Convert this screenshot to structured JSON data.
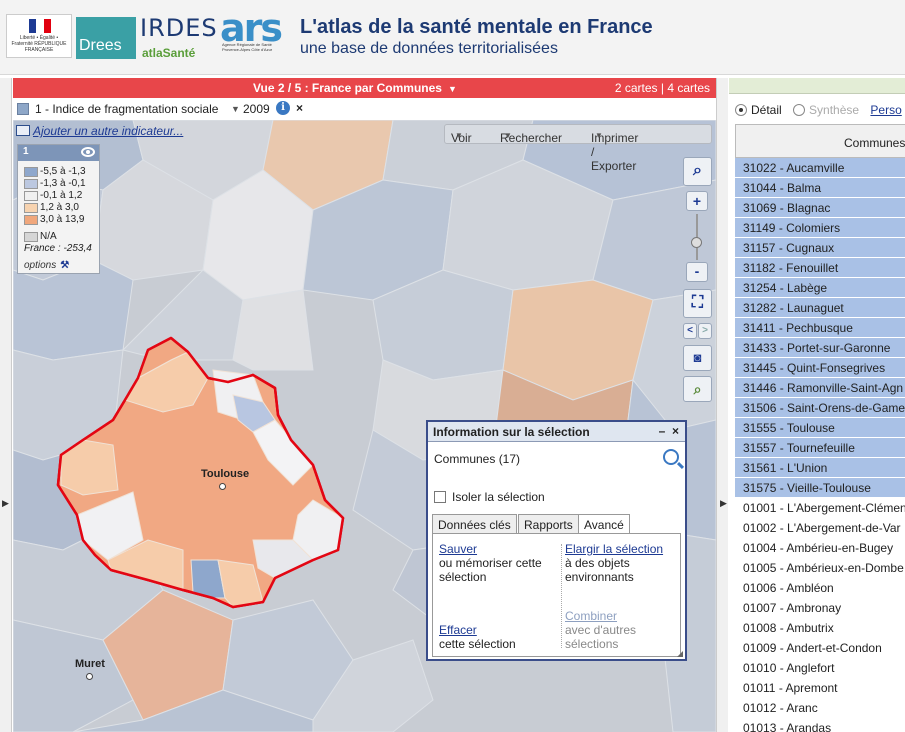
{
  "header": {
    "logo_rf_text": "Liberté • Égalité • Fraternité RÉPUBLIQUE FRANÇAISE",
    "logo_drees": "Drees",
    "logo_irdes": "IRDES",
    "logo_atlas": "atlaSanté",
    "logo_ars": "ars",
    "logo_ars_sub": "Agence Régionale de Santé Provence-Alpes Côte d'Azur",
    "title": "L'atlas de la santé mentale en France",
    "subtitle": "une base de données territorialisées"
  },
  "viewbar": {
    "title": "Vue 2 / 5 : France par Communes",
    "cards": "2 cartes  | 4 cartes",
    "color": "#e8464a"
  },
  "indicator": {
    "label": "1 - Indice de fragmentation sociale",
    "year": "2009",
    "info": "i",
    "close": "×"
  },
  "map": {
    "add_indicator": "Ajouter un autre indicateur...",
    "toolbar": [
      "Voir",
      "Rechercher",
      "Imprimer / Exporter"
    ],
    "cities": [
      {
        "name": "Toulouse"
      },
      {
        "name": "Muret"
      }
    ],
    "zoom_in": "+",
    "zoom_out": "-"
  },
  "legend": {
    "number": "1",
    "classes": [
      {
        "label": "-5,5 à -1,3",
        "color": "#8ea7cc"
      },
      {
        "label": "-1,3 à -0,1",
        "color": "#bcc8e0"
      },
      {
        "label": "-0,1 à 1,2",
        "color": "#f0f0f0"
      },
      {
        "label": "1,2 à 3,0",
        "color": "#f7d3b0"
      },
      {
        "label": "3,0 à 13,9",
        "color": "#f0a77c"
      }
    ],
    "na": "N/A",
    "france": "France : -253,4",
    "options": "options"
  },
  "info_panel": {
    "title": "Information sur la sélection",
    "minimize": "–",
    "close": "×",
    "count": "Communes (17)",
    "isolate": "Isoler la sélection",
    "tabs": [
      "Données clés",
      "Rapports",
      "Avancé"
    ],
    "actions": {
      "save": {
        "link": "Sauver",
        "desc": "ou mémoriser cette sélection"
      },
      "expand": {
        "link": "Elargir la sélection",
        "desc": "à des objets environnants"
      },
      "clear": {
        "link": "Effacer",
        "desc": "cette sélection"
      },
      "combine": {
        "link": "Combiner",
        "desc": "avec d'autres sélections"
      }
    }
  },
  "right_panel": {
    "radio_detail": "Détail",
    "radio_synth": "Synthèse",
    "link_pers": "Perso",
    "col_header": "Communes",
    "rows": [
      {
        "label": "31022 - Aucamville",
        "selected": true
      },
      {
        "label": "31044 - Balma",
        "selected": true
      },
      {
        "label": "31069 - Blagnac",
        "selected": true
      },
      {
        "label": "31149 - Colomiers",
        "selected": true
      },
      {
        "label": "31157 - Cugnaux",
        "selected": true
      },
      {
        "label": "31182 - Fenouillet",
        "selected": true
      },
      {
        "label": "31254 - Labège",
        "selected": true
      },
      {
        "label": "31282 - Launaguet",
        "selected": true
      },
      {
        "label": "31411 - Pechbusque",
        "selected": true
      },
      {
        "label": "31433 - Portet-sur-Garonne",
        "selected": true
      },
      {
        "label": "31445 - Quint-Fonsegrives",
        "selected": true
      },
      {
        "label": "31446 - Ramonville-Saint-Agn",
        "selected": true
      },
      {
        "label": "31506 - Saint-Orens-de-Gamev",
        "selected": true
      },
      {
        "label": "31555 - Toulouse",
        "selected": true
      },
      {
        "label": "31557 - Tournefeuille",
        "selected": true
      },
      {
        "label": "31561 - L'Union",
        "selected": true
      },
      {
        "label": "31575 - Vieille-Toulouse",
        "selected": true
      },
      {
        "label": "01001 - L'Abergement-Clémen",
        "selected": false
      },
      {
        "label": "01002 - L'Abergement-de-Var",
        "selected": false
      },
      {
        "label": "01004 - Ambérieu-en-Bugey",
        "selected": false
      },
      {
        "label": "01005 - Ambérieux-en-Dombe",
        "selected": false
      },
      {
        "label": "01006 - Ambléon",
        "selected": false
      },
      {
        "label": "01007 - Ambronay",
        "selected": false
      },
      {
        "label": "01008 - Ambutrix",
        "selected": false
      },
      {
        "label": "01009 - Andert-et-Condon",
        "selected": false
      },
      {
        "label": "01010 - Anglefort",
        "selected": false
      },
      {
        "label": "01011 - Apremont",
        "selected": false
      },
      {
        "label": "01012 - Aranc",
        "selected": false
      },
      {
        "label": "01013 - Arandas",
        "selected": false
      }
    ]
  }
}
